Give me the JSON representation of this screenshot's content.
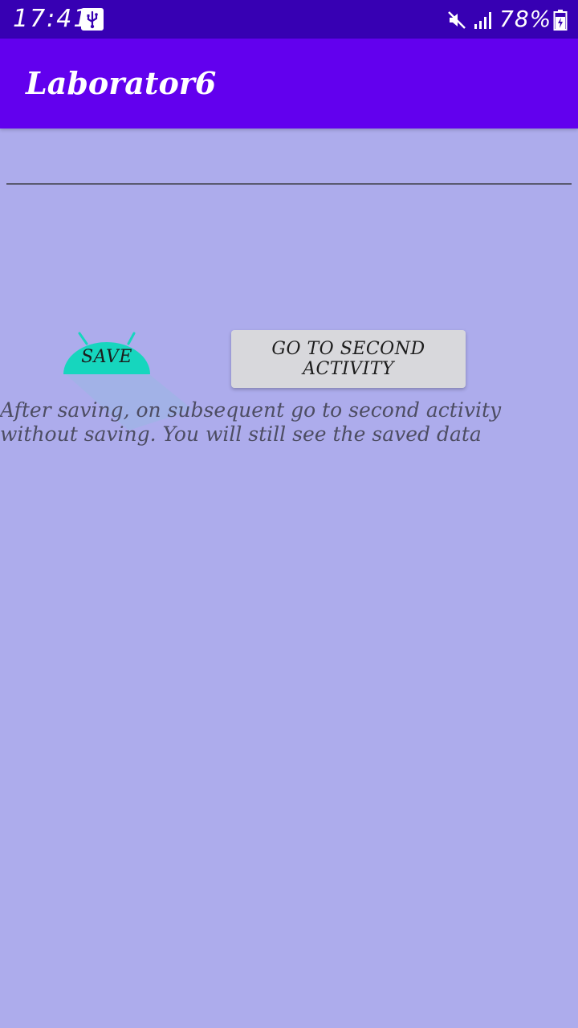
{
  "status_bar": {
    "time": "17:41",
    "battery_percent": "78%",
    "icons": [
      "usb-icon",
      "mute-icon",
      "signal-icon",
      "battery-charging-icon"
    ]
  },
  "app_bar": {
    "title": "Laborator6"
  },
  "colors": {
    "status_bar": "#3700b3",
    "app_bar": "#6200ee",
    "background": "#adacec",
    "save_button": "#16d6be",
    "button_gray": "#d8d8dc"
  },
  "edit_field": {
    "value": ""
  },
  "buttons": {
    "save_label": "SAVE",
    "second_activity_label": "GO TO SECOND ACTIVITY"
  },
  "info": {
    "text": "After saving, on subsequent go to second activity without saving. You will still see the saved data"
  }
}
